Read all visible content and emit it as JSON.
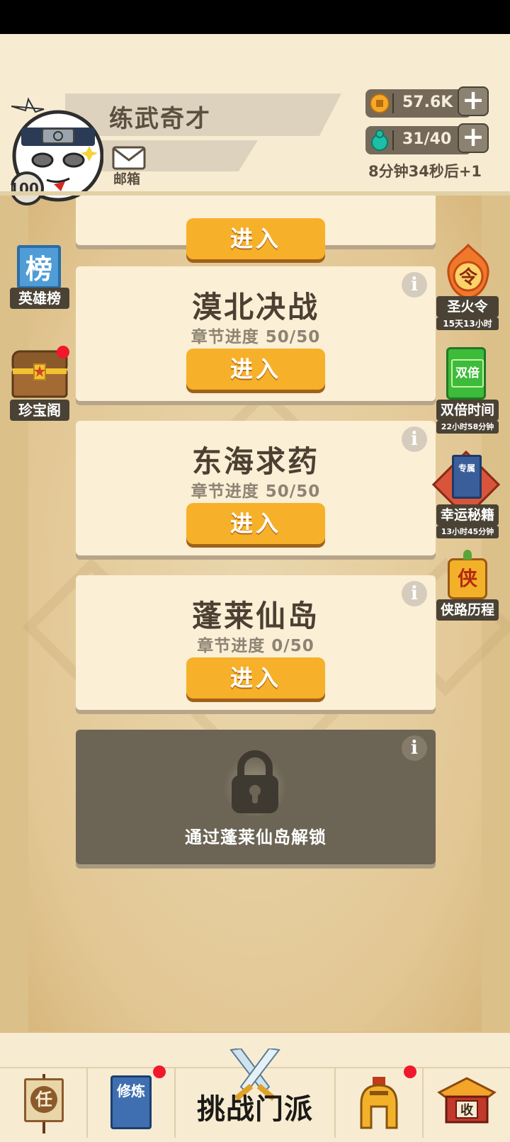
{
  "player": {
    "name": "练武奇才",
    "level": "100",
    "mail_label": "邮箱"
  },
  "resources": {
    "coins": "57.6K",
    "stamina": "31/40",
    "regen_text": "8分钟34秒后+1"
  },
  "side_left": [
    {
      "label": "英雄榜",
      "icon_text": "榜"
    },
    {
      "label": "珍宝阁"
    }
  ],
  "side_right": [
    {
      "label": "圣火令",
      "timer": "15天13小时",
      "icon_text": "令"
    },
    {
      "label": "双倍时间",
      "timer": "22小时58分钟",
      "icon_text": "双倍"
    },
    {
      "label": "幸运秘籍",
      "timer": "13小时45分钟",
      "icon_text": "专属"
    },
    {
      "label": "侠路历程",
      "icon_text": "侠"
    }
  ],
  "levels": [
    {
      "title": "",
      "progress": "",
      "button": "进入"
    },
    {
      "title": "漠北决战",
      "progress": "章节进度 50/50",
      "button": "进入"
    },
    {
      "title": "东海求药",
      "progress": "章节进度 50/50",
      "button": "进入"
    },
    {
      "title": "蓬莱仙岛",
      "progress": "章节进度 0/50",
      "button": "进入"
    }
  ],
  "locked": {
    "text": "通过蓬莱仙岛解锁"
  },
  "bottom_nav": {
    "task_icon_text": "任",
    "cultivate_icon_text": "修炼",
    "challenge_label": "挑战门派",
    "collect_icon_text": "收"
  },
  "colors": {
    "button_orange": "#f6b02a",
    "card_bg": "#fbefd6",
    "locked_bg": "#6c6455",
    "notify_red": "#f2182c"
  }
}
